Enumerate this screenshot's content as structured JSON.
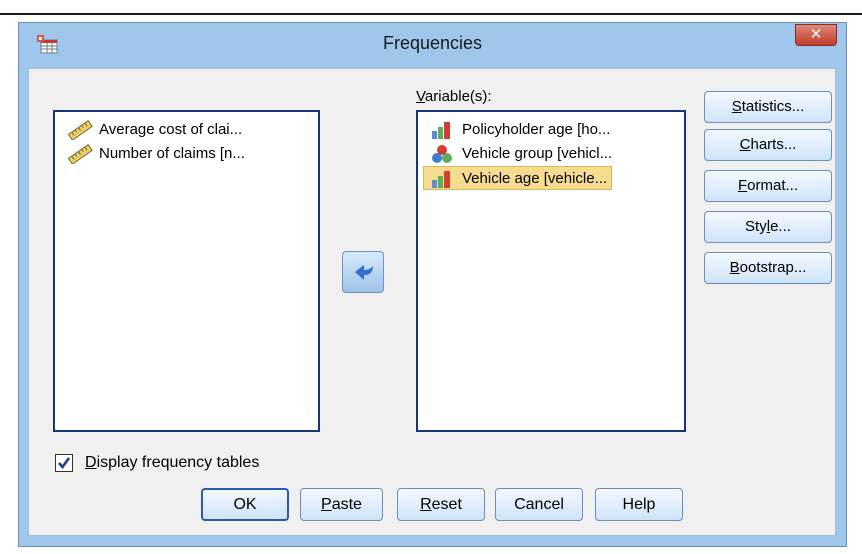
{
  "window": {
    "title": "Frequencies",
    "close_glyph": "✕"
  },
  "source_list": {
    "items": [
      {
        "label": "Average cost of clai...",
        "icon": "scale-ruler-icon"
      },
      {
        "label": "Number of claims [n...",
        "icon": "scale-ruler-icon"
      }
    ]
  },
  "target_list": {
    "label_accel": "V",
    "label_rest": "ariable(s):",
    "items": [
      {
        "label": "Policyholder age [ho...",
        "icon": "ordinal-bar-icon",
        "selected": false
      },
      {
        "label": "Vehicle group [vehicl...",
        "icon": "nominal-circles-icon",
        "selected": false
      },
      {
        "label": "Vehicle age [vehicle...",
        "icon": "ordinal-bar-icon",
        "selected": true
      }
    ]
  },
  "side_buttons": {
    "statistics": {
      "accel": "S",
      "rest": "tatistics..."
    },
    "charts": {
      "accel": "C",
      "rest": "harts..."
    },
    "format": {
      "accel": "F",
      "rest": "ormat..."
    },
    "style": {
      "pre": "Sty",
      "accel": "l",
      "rest": "e..."
    },
    "bootstrap": {
      "accel": "B",
      "rest": "ootstrap..."
    }
  },
  "display_checkbox": {
    "accel": "D",
    "rest": "isplay frequency tables",
    "checked": true
  },
  "bottom_buttons": {
    "ok": {
      "label": "OK"
    },
    "paste": {
      "accel": "P",
      "rest": "aste"
    },
    "reset": {
      "accel": "R",
      "rest": "eset"
    },
    "cancel": {
      "label": "Cancel"
    },
    "help": {
      "label": "Help"
    }
  },
  "colors": {
    "frame": "#9fc7ec",
    "selection": "#f7dc8f",
    "list_border": "#17357a",
    "close": "#c0392b"
  }
}
